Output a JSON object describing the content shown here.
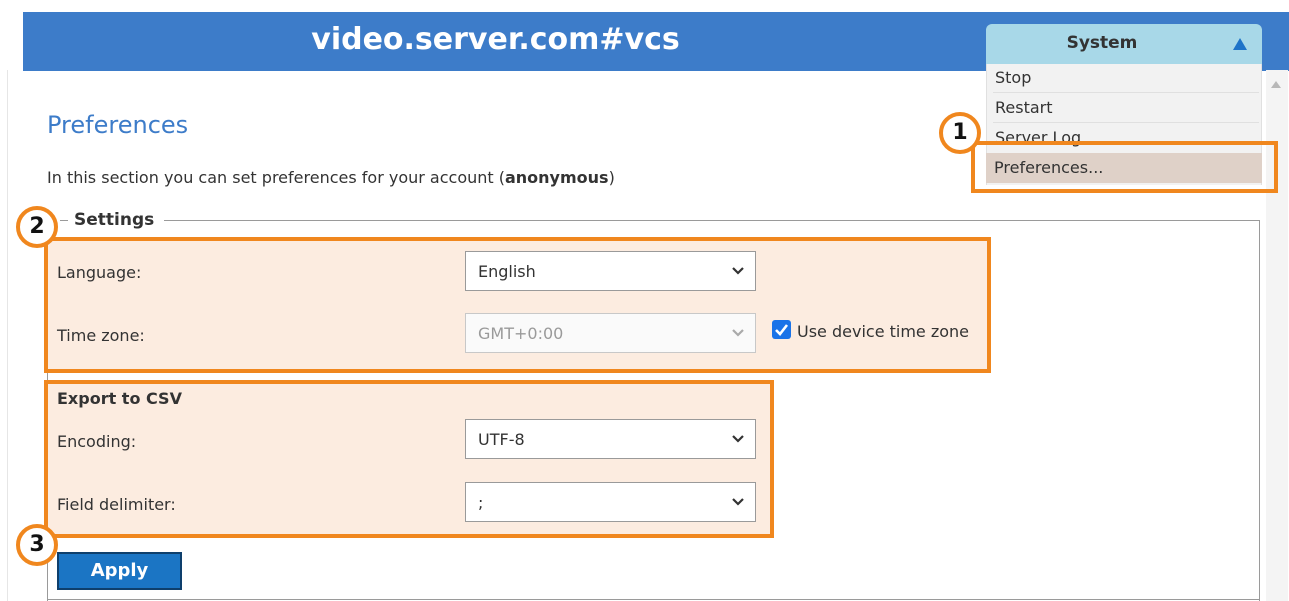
{
  "header": {
    "title": "video.server.com#vcs"
  },
  "system_menu": {
    "title": "System",
    "items": [
      "Stop",
      "Restart",
      "Server Log",
      "Preferences..."
    ]
  },
  "page": {
    "title": "Preferences",
    "intro_prefix": "In this section you can set preferences for your account (",
    "intro_user": "anonymous",
    "intro_suffix": ")"
  },
  "settings": {
    "legend": "Settings",
    "language_label": "Language:",
    "language_value": "English",
    "timezone_label": "Time zone:",
    "timezone_value": "GMT+0:00",
    "use_device_tz_label": "Use device time zone",
    "use_device_tz_checked": true
  },
  "export": {
    "heading": "Export to CSV",
    "encoding_label": "Encoding:",
    "encoding_value": "UTF-8",
    "delimiter_label": "Field delimiter:",
    "delimiter_value": ";"
  },
  "apply_label": "Apply",
  "callouts": [
    "1",
    "2",
    "3"
  ],
  "colors": {
    "accent": "#3d7cc9",
    "highlight": "#f0871e",
    "highlight_fill": "#fcece0"
  }
}
